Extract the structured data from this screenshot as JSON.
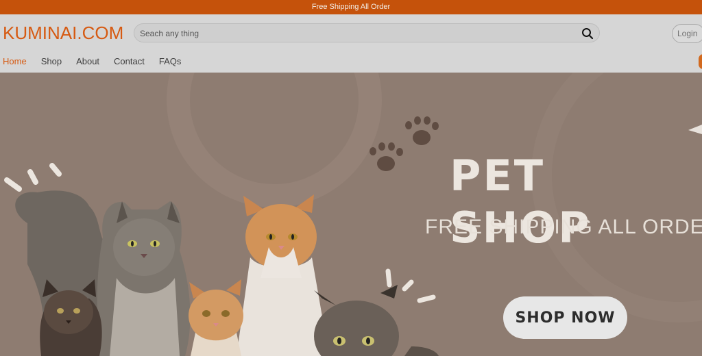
{
  "topbar": {
    "text": "Free Shipping All Order"
  },
  "header": {
    "logo": "KUMINAI.COM",
    "search": {
      "placeholder": "Seach any thing",
      "value": ""
    },
    "login_label": "Login"
  },
  "nav": {
    "items": [
      {
        "label": "Home",
        "active": true
      },
      {
        "label": "Shop"
      },
      {
        "label": "About"
      },
      {
        "label": "Contact"
      },
      {
        "label": "FAQs"
      }
    ]
  },
  "hero": {
    "title": "PET SHOP",
    "subtitle": "FREE SHIPPING ALL ORDER",
    "cta_label": "SHOP NOW"
  },
  "colors": {
    "accent": "#d65a12",
    "topbar_bg": "#c5520b",
    "header_bg": "#d6d6d6",
    "hero_bg": "#8e7c71"
  },
  "icons": [
    "search-icon",
    "paw-icon",
    "cart-icon"
  ]
}
